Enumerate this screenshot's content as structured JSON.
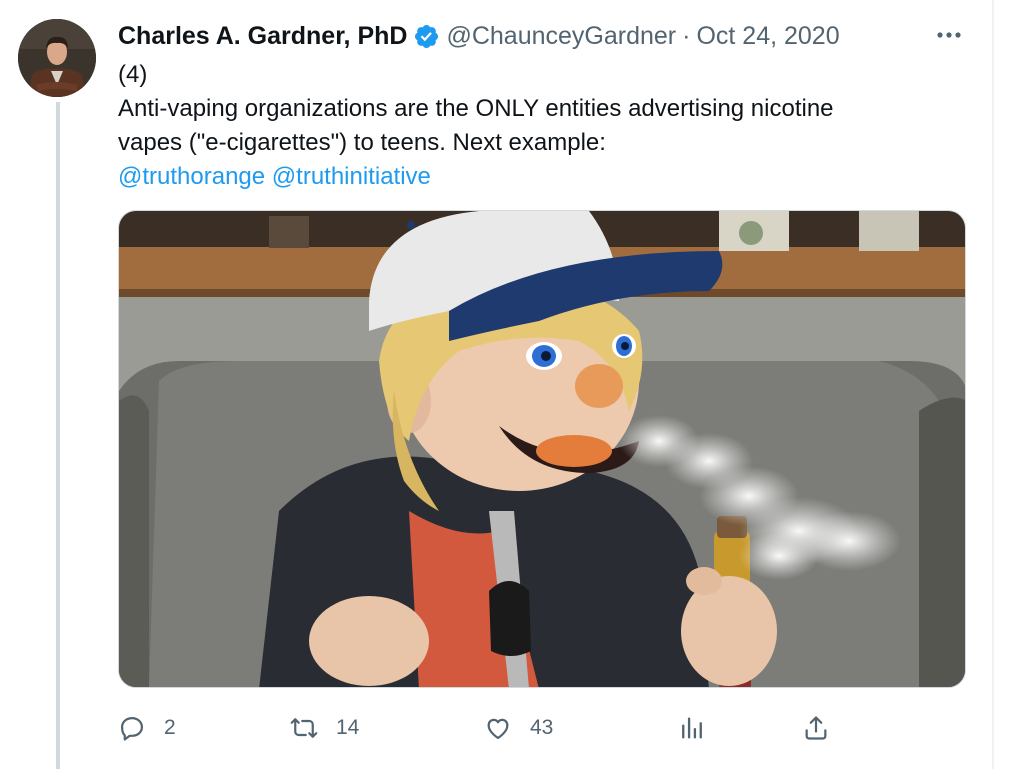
{
  "author": {
    "display_name": "Charles A. Gardner, PhD",
    "verified": true,
    "handle": "@ChaunceyGardner",
    "separator": "·",
    "date": "Oct 24, 2020"
  },
  "more_label": "···",
  "tweet": {
    "lines": [
      "(4)",
      "Anti-vaping organizations are the ONLY entities advertising nicotine",
      "vapes (\"e-cigarettes\") to teens.  Next example:"
    ],
    "mentions": [
      "@truthorange",
      "@truthinitiative"
    ]
  },
  "media": {
    "description_icon": "photo",
    "subject": "puppet wearing white cap exhaling vape cloud"
  },
  "actions": {
    "reply": {
      "icon": "reply-icon",
      "count": "2"
    },
    "retweet": {
      "icon": "retweet-icon",
      "count": "14"
    },
    "like": {
      "icon": "heart-icon",
      "count": "43"
    },
    "views": {
      "icon": "analytics-icon"
    },
    "share": {
      "icon": "share-icon"
    }
  },
  "colors": {
    "accent": "#1d9bf0",
    "text": "#0f1419",
    "muted": "#536471",
    "thread_line": "#cfd9de"
  }
}
